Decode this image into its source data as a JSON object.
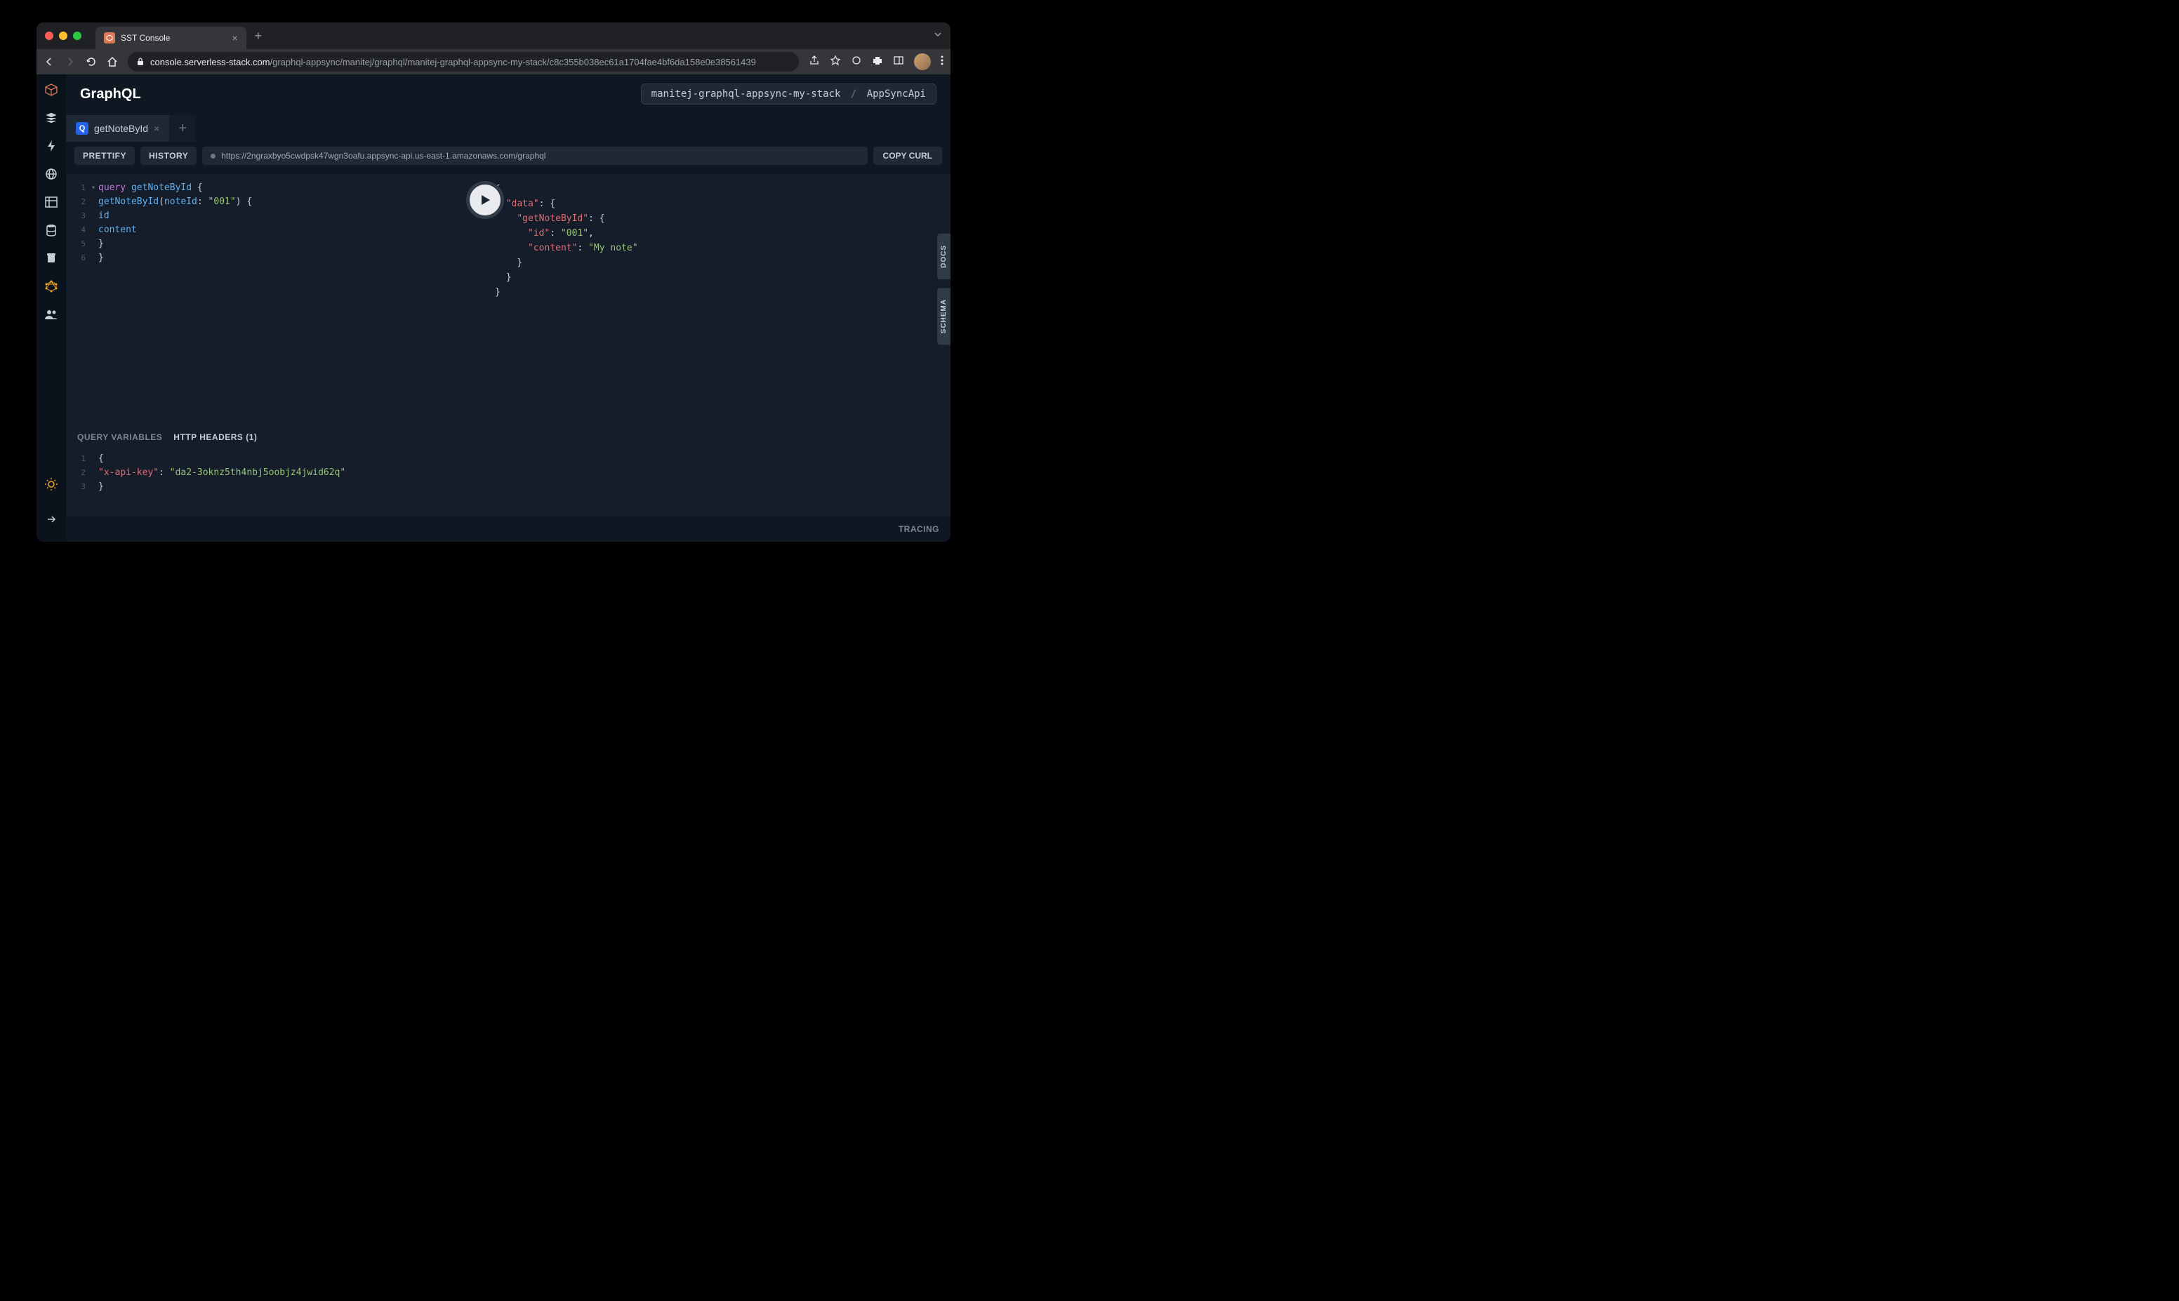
{
  "browser": {
    "tab_title": "SST Console",
    "url_domain": "console.serverless-stack.com",
    "url_path": "/graphql-appsync/manitej/graphql/manitej-graphql-appsync-my-stack/c8c355b038ec61a1704fae4bf6da158e0e38561439"
  },
  "header": {
    "title": "GraphQL",
    "breadcrumb_stack": "manitej-graphql-appsync-my-stack",
    "breadcrumb_sep": "/",
    "breadcrumb_api": "AppSyncApi"
  },
  "query_tab": {
    "badge": "Q",
    "name": "getNoteById"
  },
  "toolbar": {
    "prettify": "PRETTIFY",
    "history": "HISTORY",
    "endpoint": "https://2ngraxbyo5cwdpsk47wgn3oafu.appsync-api.us-east-1.amazonaws.com/graphql",
    "copy_curl": "COPY CURL"
  },
  "query": {
    "lines": [
      {
        "n": "1",
        "fold": "▾",
        "tokens": [
          {
            "t": "query",
            "c": "kw"
          },
          {
            "t": " "
          },
          {
            "t": "getNoteById",
            "c": "func"
          },
          {
            "t": " {",
            "c": "punc"
          }
        ]
      },
      {
        "n": "2",
        "tokens": [
          {
            "t": "  "
          },
          {
            "t": "getNoteById",
            "c": "prop"
          },
          {
            "t": "(",
            "c": "punc"
          },
          {
            "t": "noteId",
            "c": "prop"
          },
          {
            "t": ":",
            "c": "punc"
          },
          {
            "t": " "
          },
          {
            "t": "\"001\"",
            "c": "str"
          },
          {
            "t": ")",
            "c": "punc"
          },
          {
            "t": " {",
            "c": "punc"
          }
        ]
      },
      {
        "n": "3",
        "tokens": [
          {
            "t": "    "
          },
          {
            "t": "id",
            "c": "prop"
          }
        ]
      },
      {
        "n": "4",
        "tokens": [
          {
            "t": "    "
          },
          {
            "t": "content",
            "c": "prop"
          }
        ]
      },
      {
        "n": "5",
        "tokens": [
          {
            "t": "  }",
            "c": "punc"
          }
        ]
      },
      {
        "n": "6",
        "tokens": [
          {
            "t": "}",
            "c": "punc"
          }
        ]
      }
    ]
  },
  "bottom_tabs": {
    "query_vars": "QUERY VARIABLES",
    "http_headers": "HTTP HEADERS (1)"
  },
  "headers_editor": {
    "lines": [
      {
        "n": "1",
        "tokens": [
          {
            "t": "{",
            "c": "punc"
          }
        ]
      },
      {
        "n": "2",
        "tokens": [
          {
            "t": "  "
          },
          {
            "t": "\"x-api-key\"",
            "c": "key"
          },
          {
            "t": ":",
            "c": "punc"
          },
          {
            "t": " "
          },
          {
            "t": "\"da2-3oknz5th4nbj5oobjz4jwid62q\"",
            "c": "str"
          }
        ]
      },
      {
        "n": "3",
        "tokens": [
          {
            "t": "}",
            "c": "punc"
          }
        ]
      }
    ]
  },
  "response": {
    "lines": [
      {
        "fold": "▾",
        "indent": 0,
        "tokens": [
          {
            "t": "{",
            "c": "punc"
          }
        ]
      },
      {
        "fold": "▾",
        "indent": 1,
        "tokens": [
          {
            "t": "\"data\"",
            "c": "json-key"
          },
          {
            "t": ": {",
            "c": "punc"
          }
        ]
      },
      {
        "indent": 2,
        "tokens": [
          {
            "t": "\"getNoteById\"",
            "c": "json-key"
          },
          {
            "t": ": {",
            "c": "punc"
          }
        ]
      },
      {
        "indent": 3,
        "tokens": [
          {
            "t": "\"id\"",
            "c": "json-key"
          },
          {
            "t": ": ",
            "c": "punc"
          },
          {
            "t": "\"001\"",
            "c": "json-str"
          },
          {
            "t": ",",
            "c": "punc"
          }
        ]
      },
      {
        "indent": 3,
        "tokens": [
          {
            "t": "\"content\"",
            "c": "json-key"
          },
          {
            "t": ": ",
            "c": "punc"
          },
          {
            "t": "\"My note\"",
            "c": "json-str"
          }
        ]
      },
      {
        "indent": 2,
        "tokens": [
          {
            "t": "}",
            "c": "punc"
          }
        ]
      },
      {
        "indent": 1,
        "tokens": [
          {
            "t": "}",
            "c": "punc"
          }
        ]
      },
      {
        "indent": 0,
        "tokens": [
          {
            "t": "}",
            "c": "punc"
          }
        ]
      }
    ]
  },
  "side_tabs": {
    "docs": "DOCS",
    "schema": "SCHEMA"
  },
  "footer": {
    "tracing": "TRACING"
  }
}
